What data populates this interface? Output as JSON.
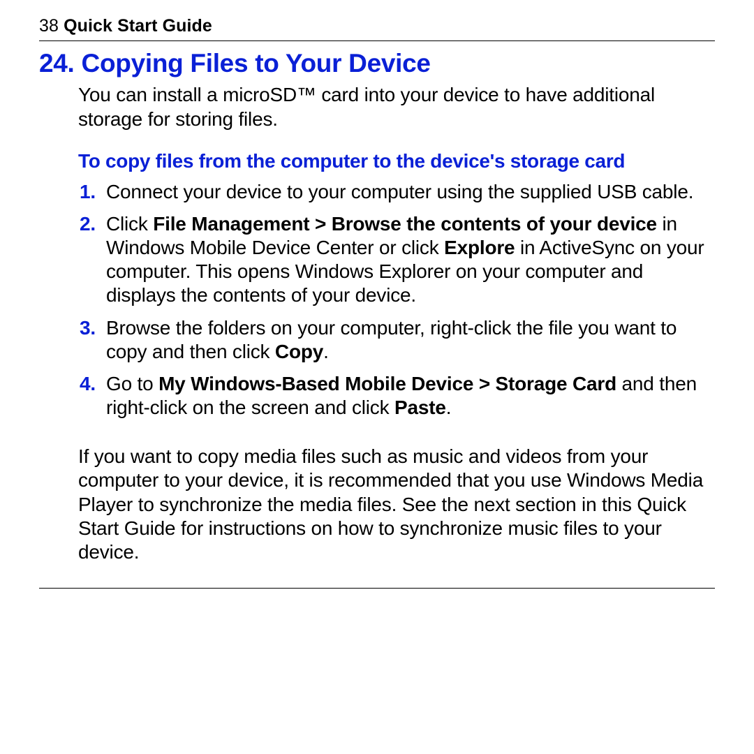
{
  "header": {
    "page_number": "38",
    "title": "Quick Start Guide"
  },
  "section": {
    "number": "24.",
    "title": "Copying Files to Your Device",
    "intro": "You can install a microSD™ card into your device to have additional storage for storing files.",
    "sub_heading": "To copy files from the computer to the device's storage card",
    "steps": {
      "s1": {
        "num": "1.",
        "text": "Connect your device to your computer using the supplied USB cable."
      },
      "s2": {
        "num": "2.",
        "pre1": "Click ",
        "b1": "File Management > Browse the contents of your device",
        "mid1": " in Windows Mobile Device Center or click ",
        "b2": "Explore",
        "post1": " in ActiveSync on your computer. This opens Windows Explorer on your computer and displays the contents of your device."
      },
      "s3": {
        "num": "3.",
        "pre1": "Browse the folders on your computer, right-click the file you want to copy and then click ",
        "b1": "Copy",
        "post1": "."
      },
      "s4": {
        "num": "4.",
        "pre1": "Go to ",
        "b1": "My Windows-Based Mobile Device > Storage Card",
        "mid1": " and then right-click on the screen and click ",
        "b2": "Paste",
        "post1": "."
      }
    },
    "closing": "If you want to copy media files such as music and videos from your computer to your device, it is recommended that you use Windows Media Player to synchronize the media files. See the next section in this Quick Start Guide for instructions on how to synchronize music files to your device."
  }
}
